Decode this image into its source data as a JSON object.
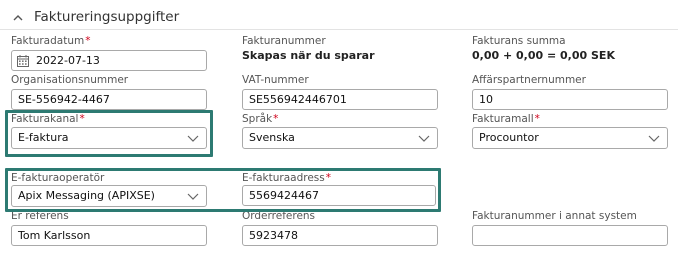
{
  "section": {
    "title": "Faktureringsuppgifter",
    "collapse_icon": "chevron-up-icon"
  },
  "fields": {
    "invoice_date": {
      "label": "Fakturadatum",
      "required": "*",
      "value": "2022-07-13",
      "icon": "calendar-icon"
    },
    "invoice_number": {
      "label": "Fakturanummer",
      "value": "Skapas när du sparar"
    },
    "invoice_sum": {
      "label": "Fakturans summa",
      "value": "0,00 + 0,00 = 0,00 SEK"
    },
    "org_number": {
      "label": "Organisationsnummer",
      "value": "SE-556942-4467"
    },
    "vat_number": {
      "label": "VAT-nummer",
      "value": "SE556942446701"
    },
    "partner_number": {
      "label": "Affärspartnernummer",
      "value": "10"
    },
    "invoice_channel": {
      "label": "Fakturakanal",
      "required": "*",
      "value": "E-faktura"
    },
    "language": {
      "label": "Språk",
      "required": "*",
      "value": "Svenska"
    },
    "invoice_template": {
      "label": "Fakturamall",
      "required": "*",
      "value": "Procountor"
    },
    "einvoice_operator": {
      "label": "E-fakturaoperatör",
      "value": "Apix Messaging (APIXSE)"
    },
    "einvoice_address": {
      "label": "E-fakturaadress",
      "required": "*",
      "value": "5569424467"
    },
    "your_reference": {
      "label": "Er referens",
      "value": "Tom Karlsson"
    },
    "order_reference": {
      "label": "Orderreferens",
      "value": "5923478"
    },
    "other_system_number": {
      "label": "Fakturanummer i annat system",
      "value": ""
    }
  },
  "colors": {
    "highlight": "#2d7a72",
    "required": "#d0021b"
  }
}
